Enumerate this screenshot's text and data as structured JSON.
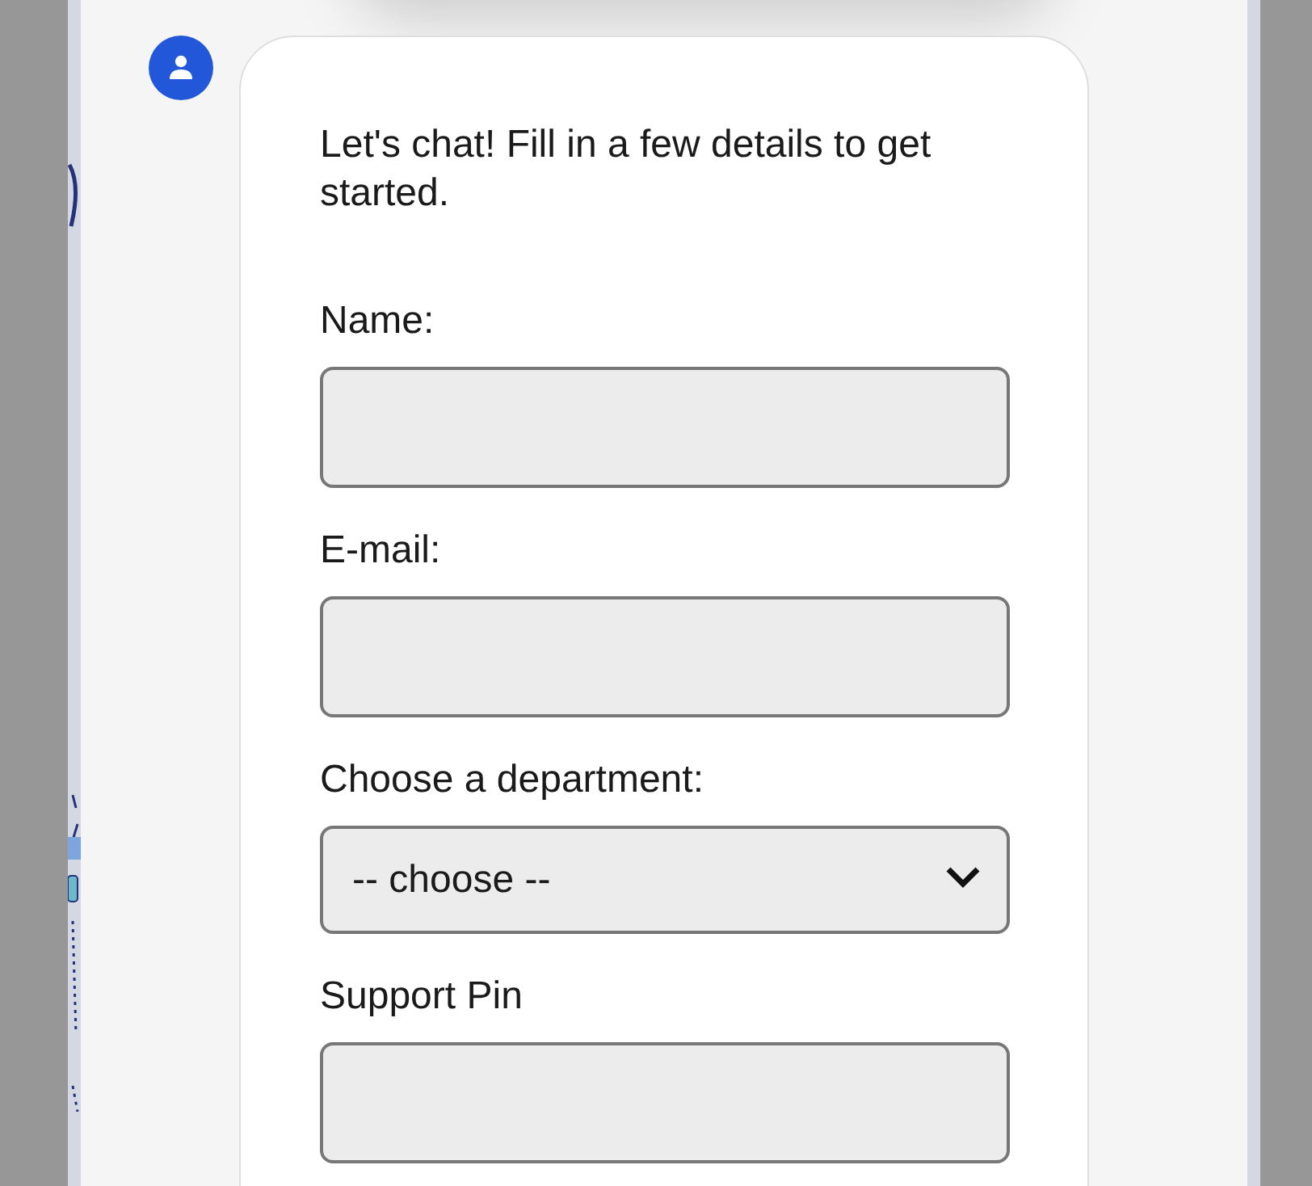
{
  "chat": {
    "intro": "Let's chat! Fill in a few details to get started.",
    "fields": [
      {
        "kind": "text",
        "label": "Name:"
      },
      {
        "kind": "text",
        "label": "E-mail:"
      },
      {
        "kind": "select",
        "label": "Choose a department:",
        "value": "-- choose --"
      },
      {
        "kind": "text",
        "label": "Support Pin"
      }
    ]
  }
}
